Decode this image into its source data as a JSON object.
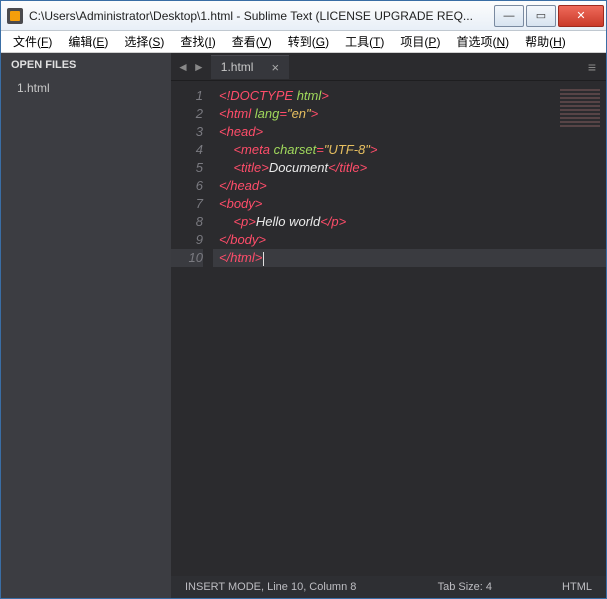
{
  "title": "C:\\Users\\Administrator\\Desktop\\1.html - Sublime Text (LICENSE UPGRADE REQ...",
  "menu": [
    "文件(F)",
    "编辑(E)",
    "选择(S)",
    "查找(I)",
    "查看(V)",
    "转到(G)",
    "工具(T)",
    "项目(P)",
    "首选项(N)",
    "帮助(H)"
  ],
  "sidebar": {
    "header": "OPEN FILES",
    "items": [
      "1.html"
    ]
  },
  "tab": {
    "label": "1.html",
    "close": "×"
  },
  "tabbar": {
    "menu_glyph": "≡"
  },
  "code": {
    "lines": [
      [
        {
          "c": "c-pnk",
          "t": "<!"
        },
        {
          "c": "c-tag",
          "t": "DOCTYPE"
        },
        {
          "c": "c-txt",
          "t": " "
        },
        {
          "c": "c-attr",
          "t": "html"
        },
        {
          "c": "c-pnk",
          "t": ">"
        }
      ],
      [
        {
          "c": "c-pnk",
          "t": "<"
        },
        {
          "c": "c-tag",
          "t": "html"
        },
        {
          "c": "c-txt",
          "t": " "
        },
        {
          "c": "c-attr",
          "t": "lang"
        },
        {
          "c": "c-pnk",
          "t": "="
        },
        {
          "c": "c-str",
          "t": "\"en\""
        },
        {
          "c": "c-pnk",
          "t": ">"
        }
      ],
      [
        {
          "c": "c-pnk",
          "t": "<"
        },
        {
          "c": "c-tag",
          "t": "head"
        },
        {
          "c": "c-pnk",
          "t": ">"
        }
      ],
      [
        {
          "c": "c-txt",
          "t": "    "
        },
        {
          "c": "c-pnk",
          "t": "<"
        },
        {
          "c": "c-tag",
          "t": "meta"
        },
        {
          "c": "c-txt",
          "t": " "
        },
        {
          "c": "c-attr",
          "t": "charset"
        },
        {
          "c": "c-pnk",
          "t": "="
        },
        {
          "c": "c-str",
          "t": "\"UTF-8\""
        },
        {
          "c": "c-pnk",
          "t": ">"
        }
      ],
      [
        {
          "c": "c-txt",
          "t": "    "
        },
        {
          "c": "c-pnk",
          "t": "<"
        },
        {
          "c": "c-tag",
          "t": "title"
        },
        {
          "c": "c-pnk",
          "t": ">"
        },
        {
          "c": "c-txt",
          "t": "Document"
        },
        {
          "c": "c-pnk",
          "t": "</"
        },
        {
          "c": "c-tag",
          "t": "title"
        },
        {
          "c": "c-pnk",
          "t": ">"
        }
      ],
      [
        {
          "c": "c-pnk",
          "t": "</"
        },
        {
          "c": "c-tag",
          "t": "head"
        },
        {
          "c": "c-pnk",
          "t": ">"
        }
      ],
      [
        {
          "c": "c-pnk",
          "t": "<"
        },
        {
          "c": "c-tag",
          "t": "body"
        },
        {
          "c": "c-pnk",
          "t": ">"
        }
      ],
      [
        {
          "c": "c-txt",
          "t": "    "
        },
        {
          "c": "c-pnk",
          "t": "<"
        },
        {
          "c": "c-tag",
          "t": "p"
        },
        {
          "c": "c-pnk",
          "t": ">"
        },
        {
          "c": "c-txt",
          "t": "Hello world"
        },
        {
          "c": "c-pnk",
          "t": "</"
        },
        {
          "c": "c-tag",
          "t": "p"
        },
        {
          "c": "c-pnk",
          "t": ">"
        }
      ],
      [
        {
          "c": "c-pnk",
          "t": "</"
        },
        {
          "c": "c-tag",
          "t": "body"
        },
        {
          "c": "c-pnk",
          "t": ">"
        }
      ],
      [
        {
          "c": "c-pnk",
          "t": "</"
        },
        {
          "c": "c-tag",
          "t": "html"
        },
        {
          "c": "c-pnk",
          "t": ">"
        }
      ]
    ],
    "highlight_line": 10
  },
  "status": {
    "left": "INSERT MODE, Line 10, Column 8",
    "tab_size": "Tab Size: 4",
    "syntax": "HTML"
  },
  "winbtn": {
    "min": "—",
    "max": "▭",
    "close": "✕"
  }
}
